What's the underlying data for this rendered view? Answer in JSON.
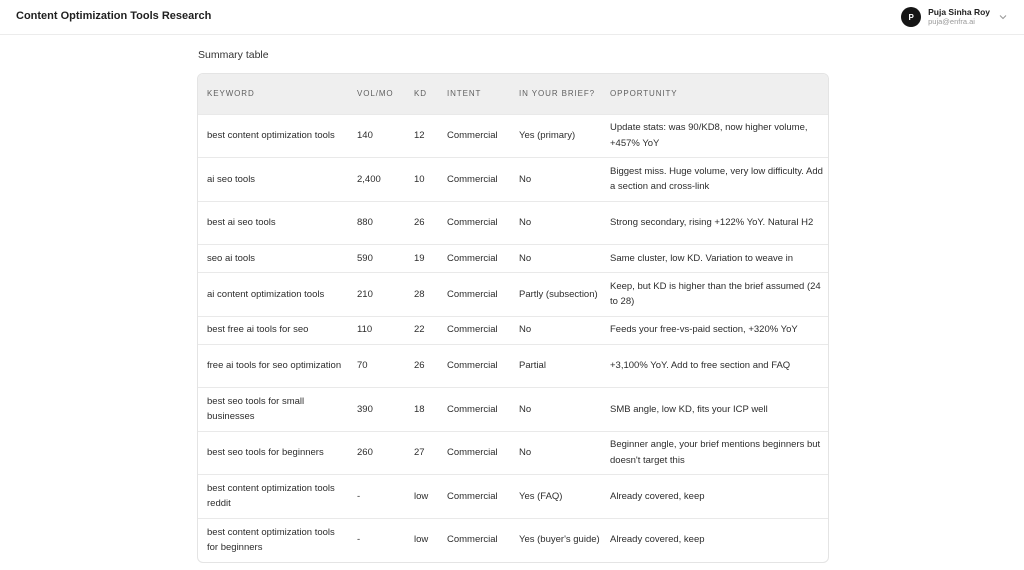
{
  "header": {
    "title": "Content Optimization Tools Research",
    "user": {
      "initial": "P",
      "name": "Puja Sinha Roy",
      "email": "puja@enfra.ai"
    }
  },
  "section": {
    "title": "Summary table"
  },
  "table": {
    "columns": [
      "KEYWORD",
      "VOL/MO",
      "KD",
      "INTENT",
      "IN YOUR BRIEF?",
      "OPPORTUNITY"
    ],
    "rows": [
      {
        "keyword": "best content optimization tools",
        "vol": "140",
        "kd": "12",
        "intent": "Commercial",
        "brief": "Yes (primary)",
        "opportunity": "Update stats: was 90/KD8, now higher volume, +457% YoY"
      },
      {
        "keyword": "ai seo tools",
        "vol": "2,400",
        "kd": "10",
        "intent": "Commercial",
        "brief": "No",
        "opportunity": "Biggest miss. Huge volume, very low difficulty. Add a section and cross-link"
      },
      {
        "keyword": "best ai seo tools",
        "vol": "880",
        "kd": "26",
        "intent": "Commercial",
        "brief": "No",
        "opportunity": "Strong secondary, rising +122% YoY. Natural H2"
      },
      {
        "keyword": "seo ai tools",
        "vol": "590",
        "kd": "19",
        "intent": "Commercial",
        "brief": "No",
        "opportunity": "Same cluster, low KD. Variation to weave in"
      },
      {
        "keyword": "ai content optimization tools",
        "vol": "210",
        "kd": "28",
        "intent": "Commercial",
        "brief": "Partly (subsection)",
        "opportunity": "Keep, but KD is higher than the brief assumed (24 to 28)"
      },
      {
        "keyword": "best free ai tools for seo",
        "vol": "110",
        "kd": "22",
        "intent": "Commercial",
        "brief": "No",
        "opportunity": "Feeds your free-vs-paid section, +320% YoY"
      },
      {
        "keyword": "free ai tools for seo optimization",
        "vol": "70",
        "kd": "26",
        "intent": "Commercial",
        "brief": "Partial",
        "opportunity": "+3,100% YoY. Add to free section and FAQ"
      },
      {
        "keyword": "best seo tools for small businesses",
        "vol": "390",
        "kd": "18",
        "intent": "Commercial",
        "brief": "No",
        "opportunity": "SMB angle, low KD, fits your ICP well"
      },
      {
        "keyword": "best seo tools for beginners",
        "vol": "260",
        "kd": "27",
        "intent": "Commercial",
        "brief": "No",
        "opportunity": "Beginner angle, your brief mentions beginners but doesn't target this"
      },
      {
        "keyword": "best content optimization tools reddit",
        "vol": "-",
        "kd": "low",
        "intent": "Commercial",
        "brief": "Yes (FAQ)",
        "opportunity": "Already covered, keep"
      },
      {
        "keyword": "best content optimization tools for beginners",
        "vol": "-",
        "kd": "low",
        "intent": "Commercial",
        "brief": "Yes (buyer's guide)",
        "opportunity": "Already covered, keep"
      }
    ]
  }
}
